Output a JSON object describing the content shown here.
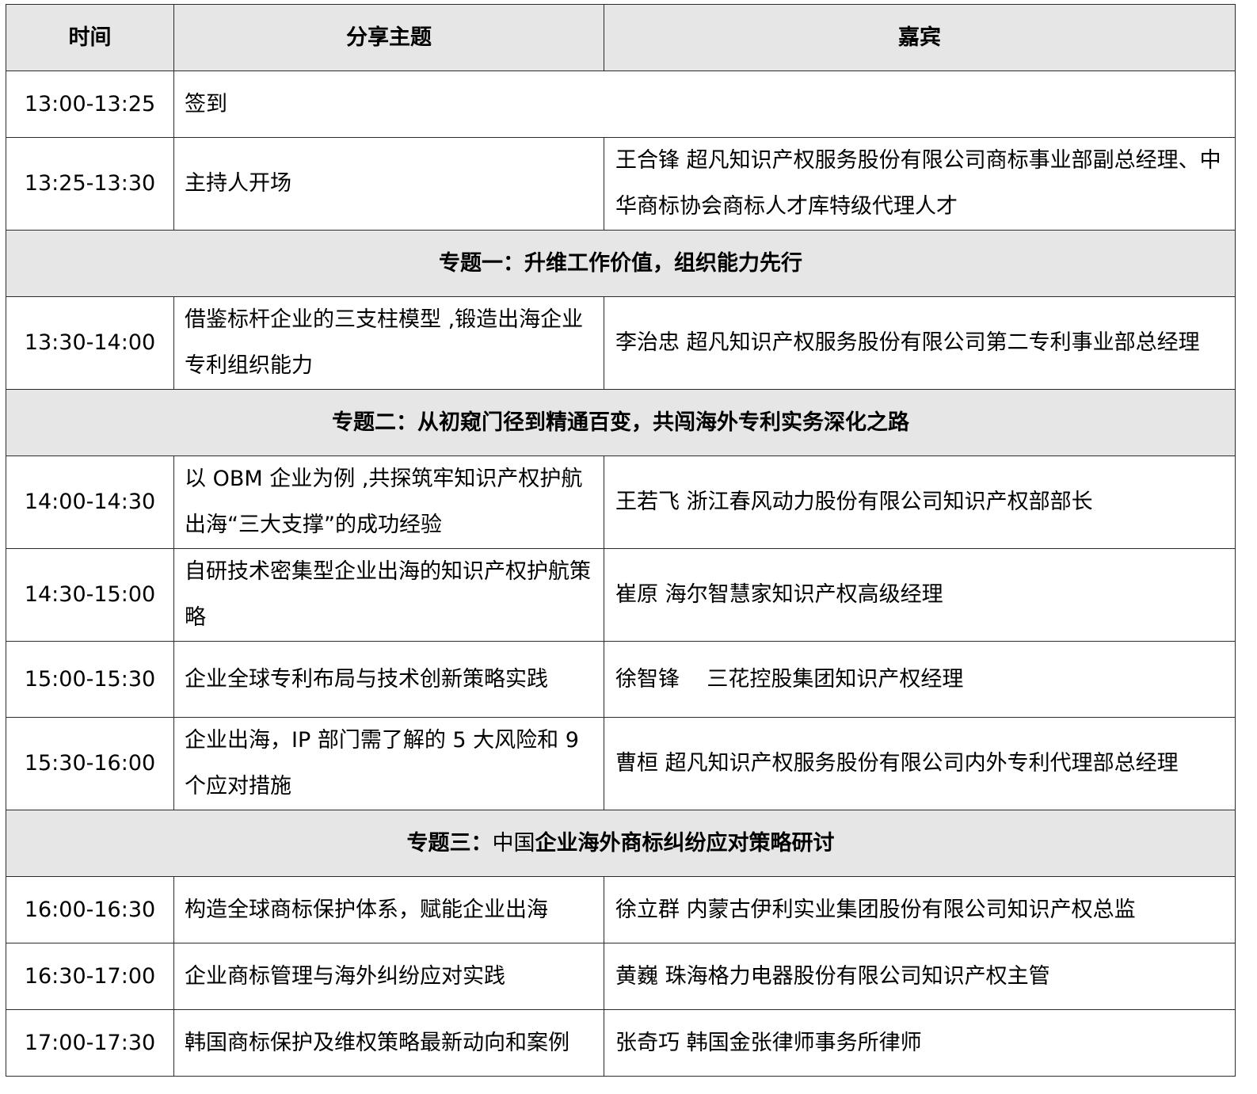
{
  "header": {
    "time": "时间",
    "topic": "分享主题",
    "guest": "嘉宾"
  },
  "rows": [
    {
      "time": "13:00-13:25",
      "topic": "签到",
      "guest": ""
    },
    {
      "time": "13:25-13:30",
      "topic": "主持人开场",
      "guest": "王合锋  超凡知识产权服务股份有限公司商标事业部副总经理、中华商标协会商标人才库特级代理人才"
    }
  ],
  "section1": {
    "title": "专题一：升维工作价值，组织能力先行"
  },
  "rows_s1": [
    {
      "time": "13:30-14:00",
      "topic": "借鉴标杆企业的三支柱模型 ,锻造出海企业专利组织能力",
      "guest": "李治忠  超凡知识产权服务股份有限公司第二专利事业部总经理"
    }
  ],
  "section2": {
    "title": "专题二：从初窥门径到精通百变，共闯海外专利实务深化之路"
  },
  "rows_s2": [
    {
      "time": "14:00-14:30",
      "topic": "以 OBM 企业为例 ,共探筑牢知识产权护航出海“三大支撑”的成功经验",
      "guest": "王若飞  浙江春风动力股份有限公司知识产权部部长"
    },
    {
      "time": "14:30-15:00",
      "topic": "自研技术密集型企业出海的知识产权护航策略",
      "guest": "崔原  海尔智慧家知识产权高级经理"
    },
    {
      "time": "15:00-15:30",
      "topic": "企业全球专利布局与技术创新策略实践",
      "guest": "徐智锋    三花控股集团知识产权经理"
    },
    {
      "time": "15:30-16:00",
      "topic": "企业出海，IP 部门需了解的 5 大风险和 9 个应对措施",
      "guest": "曹桓  超凡知识产权服务股份有限公司内外专利代理部总经理"
    }
  ],
  "section3": {
    "title_a": "专题三：",
    "title_b": "中国",
    "title_c": "企业海外商标纠纷应对策略研讨"
  },
  "rows_s3": [
    {
      "time": "16:00-16:30",
      "topic": "构造全球商标保护体系，赋能企业出海",
      "guest": "徐立群  内蒙古伊利实业集团股份有限公司知识产权总监"
    },
    {
      "time": "16:30-17:00",
      "topic": "企业商标管理与海外纠纷应对实践",
      "guest": "黄巍  珠海格力电器股份有限公司知识产权主管"
    },
    {
      "time": "17:00-17:30",
      "topic": "韩国商标保护及维权策略最新动向和案例",
      "guest": "张奇巧  韩国金张律师事务所律师"
    }
  ]
}
